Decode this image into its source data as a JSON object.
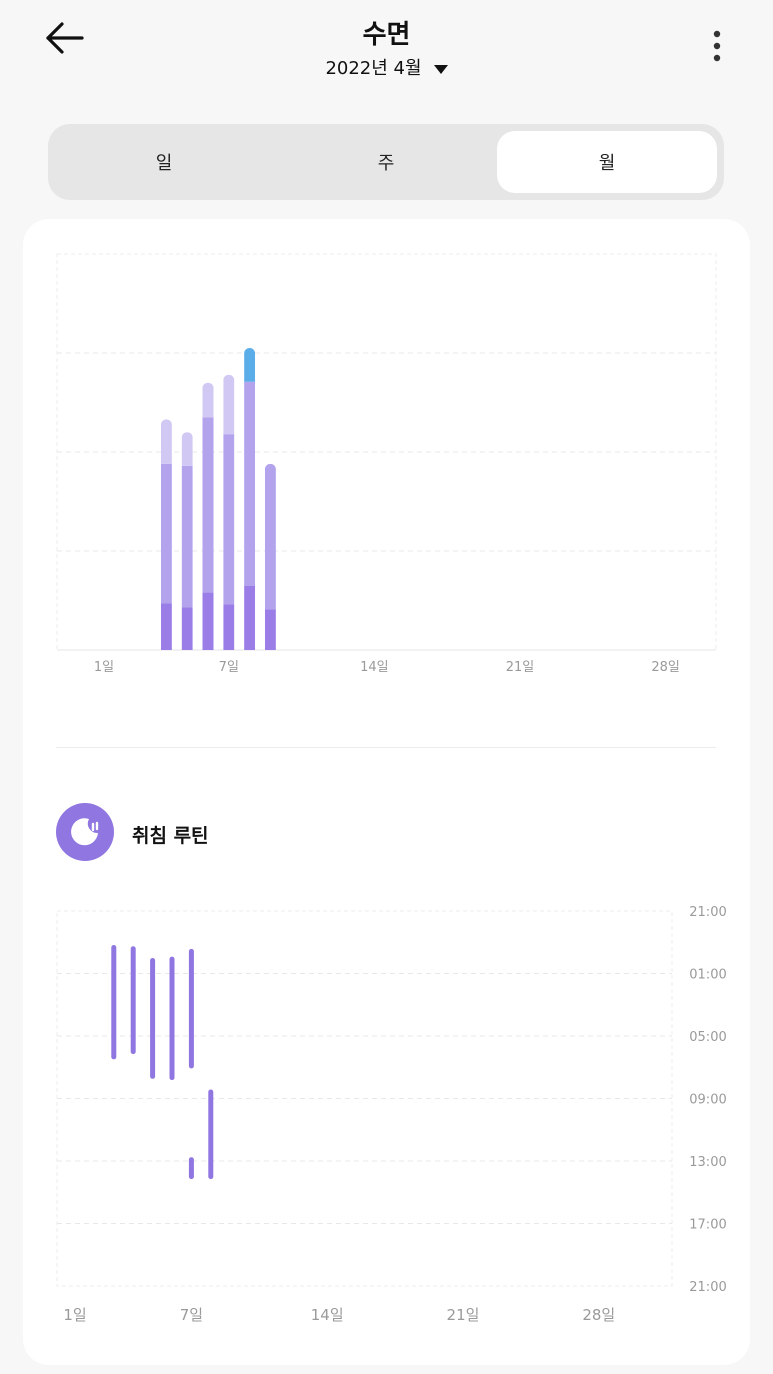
{
  "header": {
    "title": "수면",
    "date": "2022년 4월"
  },
  "tabs": [
    {
      "label": "일",
      "selected": false
    },
    {
      "label": "주",
      "selected": false
    },
    {
      "label": "월",
      "selected": true
    }
  ],
  "colors": {
    "deep": "#9a7de6",
    "light": "#b3a2ec",
    "rem": "#d2c8f4",
    "awake": "#5aade8",
    "routine": "#8f76e0",
    "grid": "#e8e8e8",
    "axis_text": "#9a9a9a"
  },
  "sleep_chart": {
    "x_ticks": [
      "1일",
      "7일",
      "14일",
      "21일",
      "28일"
    ]
  },
  "routine": {
    "label": "취침 루틴",
    "icon": "moon-icon"
  },
  "routine_chart": {
    "x_ticks": [
      "1일",
      "7일",
      "14일",
      "21일",
      "28일"
    ],
    "y_ticks": [
      "21:00",
      "01:00",
      "05:00",
      "09:00",
      "13:00",
      "17:00",
      "21:00"
    ]
  },
  "chart_data": [
    {
      "type": "bar",
      "stacked": true,
      "x": [
        4,
        5,
        6,
        7,
        8,
        9
      ],
      "x_ticks": [
        "1일",
        "7일",
        "14일",
        "21일",
        "28일"
      ],
      "xlim": [
        1,
        30
      ],
      "ylim": [
        0,
        4
      ],
      "grid": true,
      "series": [
        {
          "key": "deep",
          "values": [
            0.47,
            0.43,
            0.58,
            0.46,
            0.65,
            0.41
          ]
        },
        {
          "key": "light",
          "values": [
            1.41,
            1.43,
            1.77,
            1.72,
            2.06,
            1.47
          ]
        },
        {
          "key": "rem",
          "values": [
            0.45,
            0.34,
            0.35,
            0.6,
            0.0,
            0.0
          ]
        },
        {
          "key": "awake",
          "values": [
            0.0,
            0.0,
            0.0,
            0.0,
            0.34,
            0.0
          ]
        }
      ]
    },
    {
      "type": "range",
      "x_ticks": [
        "1일",
        "7일",
        "14일",
        "21일",
        "28일"
      ],
      "y_ticks": [
        "21:00",
        "01:00",
        "05:00",
        "09:00",
        "13:00",
        "17:00",
        "21:00"
      ],
      "xlim": [
        1,
        30
      ],
      "ylim_hours_since_21": [
        0,
        24
      ],
      "ranges": [
        {
          "x": 3,
          "start": "23:20",
          "end": "06:20"
        },
        {
          "x": 4,
          "start": "23:25",
          "end": "06:00"
        },
        {
          "x": 5,
          "start": "00:10",
          "end": "07:35"
        },
        {
          "x": 6,
          "start": "00:05",
          "end": "07:40"
        },
        {
          "x": 7,
          "start": "23:35",
          "end": "06:55"
        },
        {
          "x": 7,
          "start": "12:55",
          "end": "14:00"
        },
        {
          "x": 8,
          "start": "08:35",
          "end": "14:00"
        }
      ]
    }
  ]
}
